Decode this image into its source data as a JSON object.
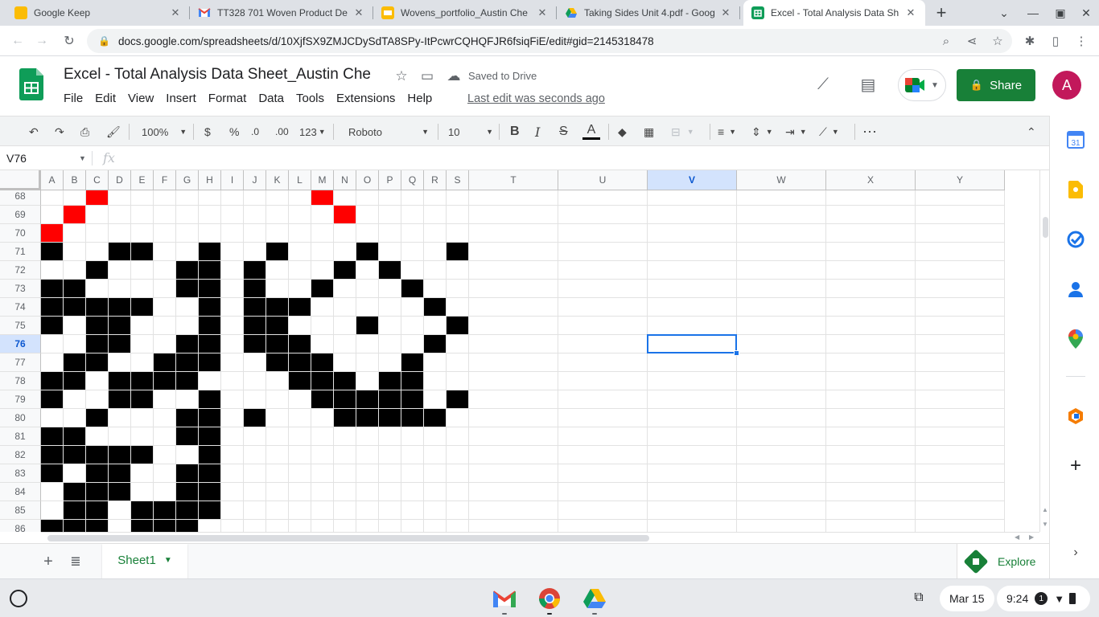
{
  "browser": {
    "tabs": [
      {
        "title": "Google Keep",
        "icon": "keep-icon"
      },
      {
        "title": "TT328 701 Woven Product De",
        "icon": "gmail-icon"
      },
      {
        "title": "Wovens_portfolio_Austin Che",
        "icon": "slides-icon"
      },
      {
        "title": "Taking Sides Unit 4.pdf - Goog",
        "icon": "drive-icon"
      },
      {
        "title": "Excel - Total Analysis Data Sh",
        "icon": "sheets-icon",
        "active": true
      }
    ],
    "url": "docs.google.com/spreadsheets/d/10XjfSX9ZMJCDySdTA8SPy-ItPcwrCQHQFJR6fsiqFiE/edit#gid=2145318478"
  },
  "doc": {
    "title": "Excel - Total Analysis Data Sheet_Austin Che",
    "saved": "Saved to Drive",
    "menus": [
      "File",
      "Edit",
      "View",
      "Insert",
      "Format",
      "Data",
      "Tools",
      "Extensions",
      "Help"
    ],
    "last_edit": "Last edit was seconds ago",
    "share": "Share",
    "avatar": "A"
  },
  "toolbar": {
    "zoom": "100%",
    "currency": "$",
    "percent": "%",
    "dec_decrease": ".0",
    "dec_increase": ".00",
    "more_formats": "123",
    "font": "Roboto",
    "font_size": "10"
  },
  "formula": {
    "cell_ref": "V76",
    "fx": "fx"
  },
  "grid": {
    "columns": [
      "A",
      "B",
      "C",
      "D",
      "E",
      "F",
      "G",
      "H",
      "I",
      "J",
      "K",
      "L",
      "M",
      "N",
      "O",
      "P",
      "Q",
      "R",
      "S",
      "T",
      "U",
      "V",
      "W",
      "X",
      "Y"
    ],
    "rows": [
      "68",
      "69",
      "70",
      "71",
      "72",
      "73",
      "74",
      "75",
      "76",
      "77",
      "78",
      "79",
      "80",
      "81",
      "82",
      "83",
      "84",
      "85",
      "86"
    ],
    "selected_column": "V",
    "selected_row": "76",
    "fill_colors": {
      "black": "#000000",
      "red": "#ff0000"
    },
    "filled_cells": {
      "68": {
        "red": [
          "C",
          "M"
        ]
      },
      "69": {
        "red": [
          "B",
          "N"
        ]
      },
      "70": {
        "red": [
          "A"
        ]
      },
      "71": {
        "black": [
          "A",
          "D",
          "E",
          "H",
          "K",
          "O",
          "S"
        ]
      },
      "72": {
        "black": [
          "C",
          "G",
          "H",
          "J",
          "N",
          "P"
        ]
      },
      "73": {
        "black": [
          "A",
          "B",
          "G",
          "H",
          "J",
          "M",
          "Q"
        ]
      },
      "74": {
        "black": [
          "A",
          "B",
          "C",
          "D",
          "E",
          "H",
          "J",
          "K",
          "L",
          "R"
        ]
      },
      "75": {
        "black": [
          "A",
          "C",
          "D",
          "H",
          "J",
          "K",
          "O",
          "S"
        ]
      },
      "76": {
        "black": [
          "C",
          "D",
          "G",
          "H",
          "J",
          "K",
          "L",
          "R"
        ]
      },
      "77": {
        "black": [
          "B",
          "C",
          "F",
          "G",
          "H",
          "K",
          "L",
          "M",
          "Q"
        ]
      },
      "78": {
        "black": [
          "A",
          "B",
          "D",
          "E",
          "F",
          "G",
          "L",
          "M",
          "N",
          "P",
          "Q"
        ]
      },
      "79": {
        "black": [
          "A",
          "D",
          "E",
          "H",
          "M",
          "N",
          "O",
          "P",
          "Q",
          "S"
        ]
      },
      "80": {
        "black": [
          "C",
          "G",
          "H",
          "J",
          "N",
          "O",
          "P",
          "Q",
          "R"
        ]
      },
      "81": {
        "black": [
          "A",
          "B",
          "G",
          "H"
        ]
      },
      "82": {
        "black": [
          "A",
          "B",
          "C",
          "D",
          "E",
          "H"
        ]
      },
      "83": {
        "black": [
          "A",
          "C",
          "D",
          "G",
          "H"
        ]
      },
      "84": {
        "black": [
          "B",
          "C",
          "D",
          "G",
          "H"
        ]
      },
      "85": {
        "black": [
          "B",
          "C",
          "E",
          "F",
          "G",
          "H"
        ]
      },
      "86": {
        "black": [
          "A",
          "B",
          "C",
          "E",
          "F",
          "G"
        ]
      }
    }
  },
  "sheets": {
    "active": "Sheet1",
    "explore": "Explore"
  },
  "shelf": {
    "date": "Mar 15",
    "time": "9:24",
    "notif_count": "1"
  },
  "colors": {
    "sheets_green": "#188038",
    "selection_blue": "#1a73e8",
    "avatar": "#c2185b"
  }
}
